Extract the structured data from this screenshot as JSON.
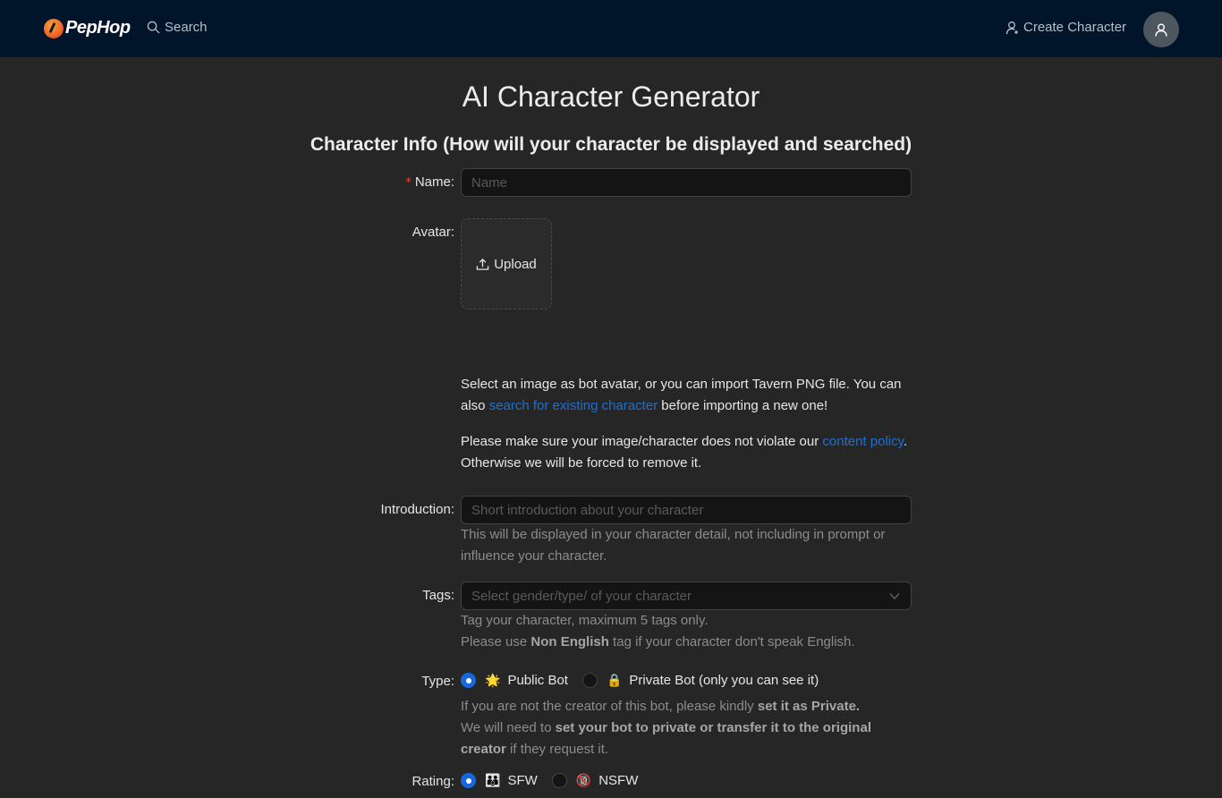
{
  "header": {
    "logo_text": "PepHop",
    "search_label": "Search",
    "create_label": "Create Character"
  },
  "main": {
    "title": "AI Character Generator",
    "section_title": "Character Info (How will your character be displayed and searched)"
  },
  "form": {
    "name": {
      "required_mark": "*",
      "label": "Name:",
      "placeholder": "Name",
      "value": ""
    },
    "avatar": {
      "label": "Avatar:",
      "upload_label": "Upload",
      "help_1_pre": "Select an image as bot avatar, or you can import Tavern PNG file. You can also ",
      "help_1_link": "search for existing character",
      "help_1_post": " before importing a new one!",
      "help_2_pre": "Please make sure your image/character does not violate our ",
      "help_2_link": "content policy",
      "help_2_post": ". Otherwise we will be forced to remove it."
    },
    "introduction": {
      "label": "Introduction:",
      "placeholder": "Short introduction about your character",
      "value": "",
      "help": "This will be displayed in your character detail, not including in prompt or influence your character."
    },
    "tags": {
      "label": "Tags:",
      "placeholder": "Select gender/type/ of your character",
      "help_1": "Tag your character, maximum 5 tags only.",
      "help_2_pre": "Please use ",
      "help_2_bold": "Non English",
      "help_2_post": " tag if your character don't speak English."
    },
    "type": {
      "label": "Type:",
      "options": [
        {
          "emoji": "🌟",
          "icon": "sparkle-icon",
          "label": "Public Bot",
          "checked": true
        },
        {
          "emoji": "🔒",
          "icon": "lock-icon",
          "label": "Private Bot (only you can see it)",
          "checked": false
        }
      ],
      "help_1_pre": "If you are not the creator of this bot, please kindly ",
      "help_1_bold": "set it as Private.",
      "help_2_pre": "We will need to ",
      "help_2_bold": "set your bot to private or transfer it to the original creator",
      "help_2_post": " if they request it."
    },
    "rating": {
      "label": "Rating:",
      "options": [
        {
          "emoji": "👪",
          "icon": "family-icon",
          "label": "SFW",
          "checked": true
        },
        {
          "emoji": "🔞",
          "icon": "no-under-18-icon",
          "label": "NSFW",
          "checked": false
        }
      ]
    }
  },
  "colors": {
    "header_bg": "#001529",
    "page_bg": "#262626",
    "accent": "#1668dc",
    "link": "#1f6fd1",
    "required": "#e04848"
  }
}
